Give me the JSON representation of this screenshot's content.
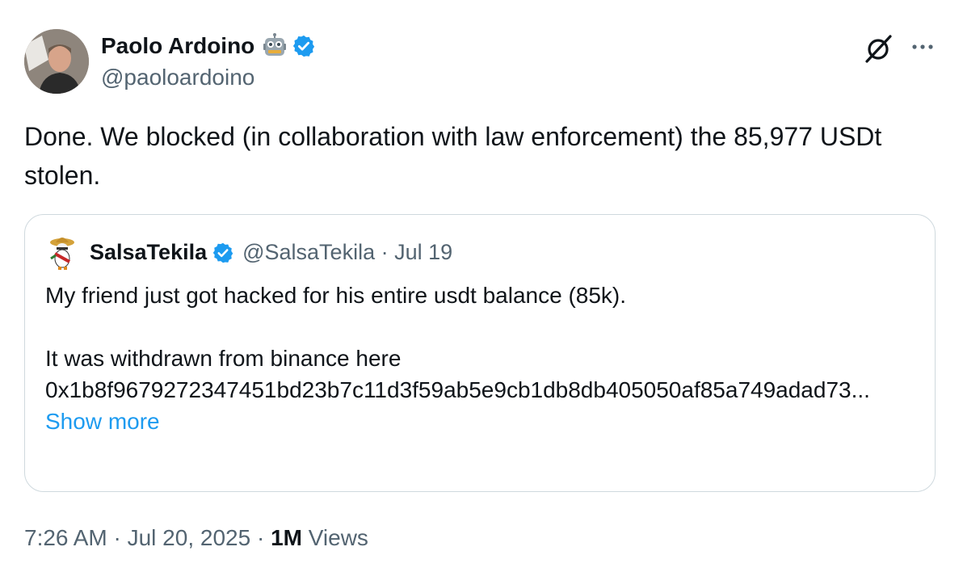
{
  "author": {
    "name": "Paolo Ardoino",
    "handle": "@paoloardoino",
    "emoji_icon": "robot-icon",
    "verified_icon": "verified-badge-icon"
  },
  "actions": {
    "grok_icon": "grok-icon",
    "more_icon": "more-options-icon"
  },
  "tweet": {
    "text": "Done. We blocked (in collaboration with law enforcement) the 85,977 USDt stolen."
  },
  "quote": {
    "name": "SalsaTekila",
    "meta": "@SalsaTekila · Jul 19",
    "line1": "My friend just got hacked for his entire usdt balance (85k).",
    "line2": "It was withdrawn from binance here",
    "line3": "0x1b8f9679272347451bd23b7c11d3f59ab5e9cb1db8db405050af85a749adad73...",
    "show_more": "Show more"
  },
  "footer": {
    "time": "7:26 AM · Jul 20, 2025 · ",
    "views_count": "1M",
    "views_label": " Views"
  },
  "colors": {
    "text": "#0f1419",
    "muted": "#536471",
    "link": "#1d9bf0",
    "verified": "#1d9bf0",
    "border": "#cfd9de"
  }
}
